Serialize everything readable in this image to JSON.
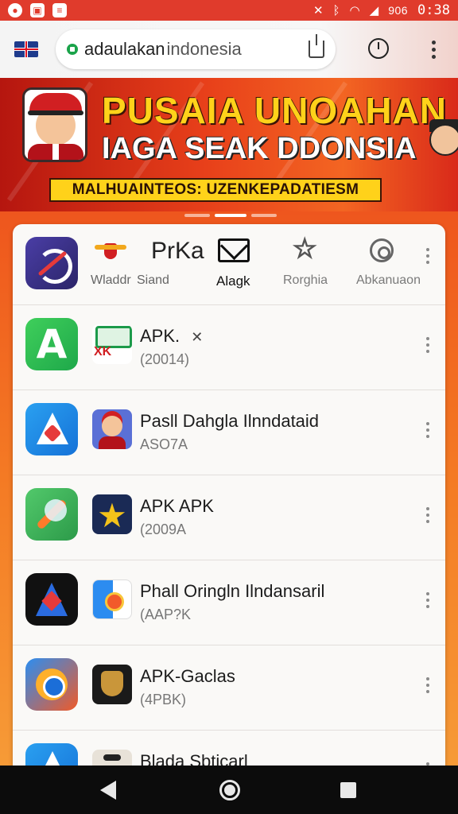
{
  "status_bar": {
    "network_text": "906",
    "time": "0:38",
    "left_icons": [
      "notification-icon",
      "image-icon",
      "news-icon"
    ],
    "right_icons": [
      "mute-icon",
      "bluetooth-icon",
      "wifi-icon",
      "signal-icon"
    ]
  },
  "browser": {
    "url_domain": "adaulakan",
    "url_rest": "indonesia",
    "secure": true
  },
  "banner": {
    "line1": "PUSAIA UNOAHAN",
    "line2": "IAGA SEAK DDONSIA",
    "line3": "MALHUAINTEOS: UZENKEPADATIESM",
    "slides": 3,
    "active_slide": 2
  },
  "top_row": {
    "app_label": "Wladdr",
    "title": "PrKa",
    "subtitle": "Siand",
    "tabs": [
      {
        "icon": "mail-icon",
        "label": "Alagk",
        "active": true
      },
      {
        "icon": "star-icon",
        "label": "Rorghia",
        "active": false
      },
      {
        "icon": "settings-icon",
        "label": "Abkanuaon",
        "active": false
      }
    ]
  },
  "apps": [
    {
      "title": "APK.",
      "title_mark": "✕",
      "subtitle": "(20014)",
      "icon": "app-green-a-icon",
      "thumb": "badge-logo-icon"
    },
    {
      "title": "Pasll Dahgla Ilnndataid",
      "subtitle": "ASO7A",
      "icon": "app-blue-arrow-icon",
      "thumb": "person-icon"
    },
    {
      "title": "APK APK",
      "subtitle": "(2009A",
      "icon": "app-leaf-icon",
      "thumb": "star-icon"
    },
    {
      "title": "Phall Oringln Ilndansaril",
      "subtitle": "(AAP?K",
      "icon": "app-dark-arrow-icon",
      "thumb": "maps-icon"
    },
    {
      "title": "APK-Gaclas",
      "subtitle": "(4PBK)",
      "icon": "app-orange-circle-icon",
      "thumb": "crest-icon"
    },
    {
      "title": "Blada Sbticarl",
      "subtitle": "",
      "icon": "app-blue-arrow-icon",
      "thumb": "person-icon"
    }
  ]
}
